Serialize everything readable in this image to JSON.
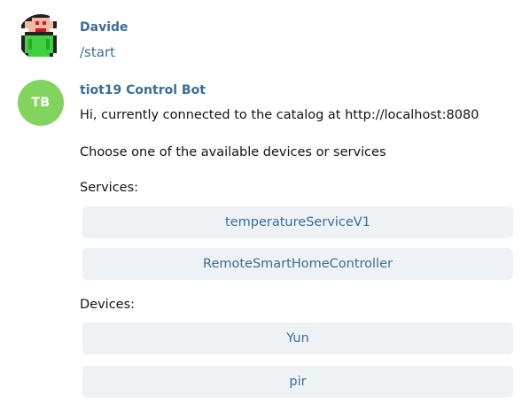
{
  "messages": {
    "user": {
      "sender": "Davide",
      "text": "/start",
      "avatar_icon": "pixel-character-icon"
    },
    "bot": {
      "sender": "tiot19 Control Bot",
      "avatar_initials": "TB",
      "avatar_color": "#82d45e",
      "line1": "Hi, currently connected to the catalog at http://localhost:8080",
      "line2": "Choose one of the available devices or services",
      "services_label": "Services:",
      "services": [
        "temperatureServiceV1",
        "RemoteSmartHomeController"
      ],
      "devices_label": "Devices:",
      "devices": [
        "Yun",
        "pir"
      ]
    }
  },
  "colors": {
    "link": "#3a6d99",
    "button_bg": "#eef2f5",
    "text": "#111111"
  }
}
